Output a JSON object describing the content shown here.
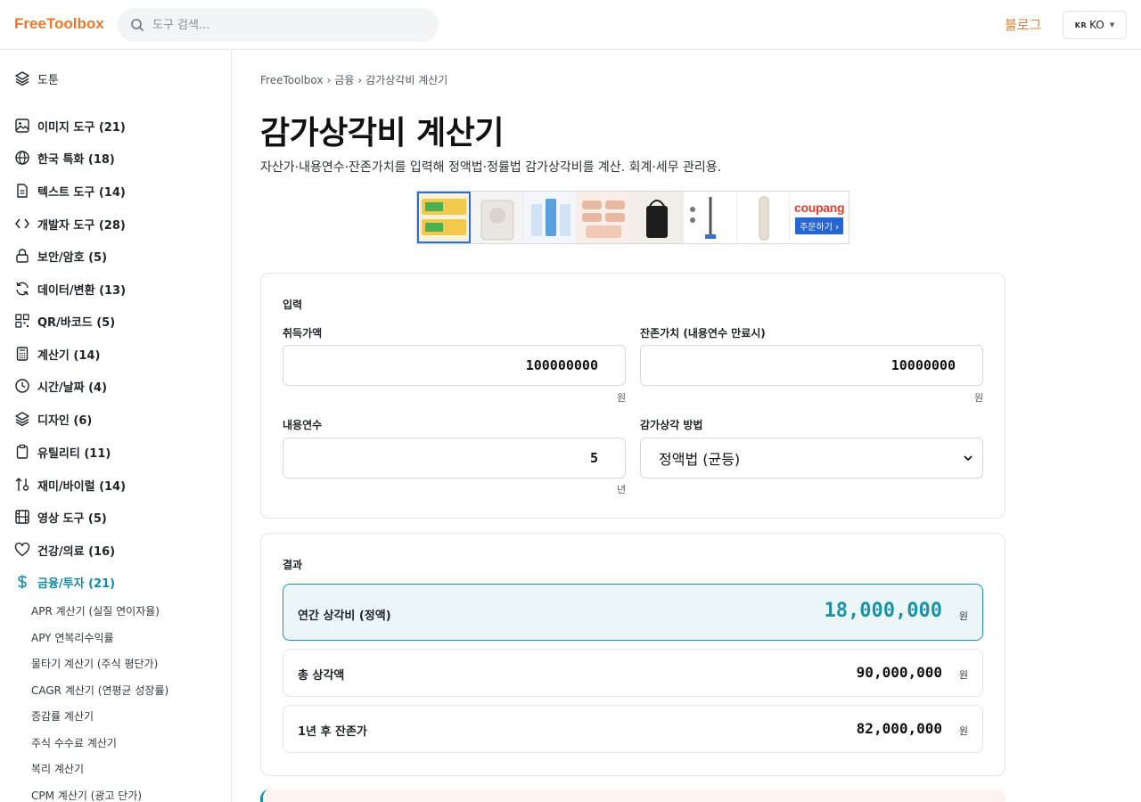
{
  "header": {
    "logo": "FreeToolbox",
    "search_placeholder": "도구 검색...",
    "blog": "블로그",
    "lang_flag": "KR",
    "lang_code": "KO"
  },
  "sidebar": {
    "top_item": "도툰",
    "categories": [
      {
        "label": "이미지 도구 (21)",
        "icon": "image-icon"
      },
      {
        "label": "한국 특화 (18)",
        "icon": "globe-icon"
      },
      {
        "label": "텍스트 도구 (14)",
        "icon": "document-icon"
      },
      {
        "label": "개발자 도구 (28)",
        "icon": "code-icon"
      },
      {
        "label": "보안/암호 (5)",
        "icon": "lock-icon"
      },
      {
        "label": "데이터/변환 (13)",
        "icon": "refresh-icon"
      },
      {
        "label": "QR/바코드 (5)",
        "icon": "qr-icon"
      },
      {
        "label": "계산기 (14)",
        "icon": "calculator-icon"
      },
      {
        "label": "시간/날짜 (4)",
        "icon": "clock-icon"
      },
      {
        "label": "디자인 (6)",
        "icon": "layers-icon"
      },
      {
        "label": "유틸리티 (11)",
        "icon": "clipboard-icon"
      },
      {
        "label": "재미/바이럴 (14)",
        "icon": "shuffle-icon"
      },
      {
        "label": "영상 도구 (5)",
        "icon": "film-icon"
      },
      {
        "label": "건강/의료 (16)",
        "icon": "heart-icon"
      },
      {
        "label": "금융/투자 (21)",
        "icon": "dollar-icon"
      }
    ],
    "finance_items": [
      "APR 계산기 (실질 연이자율)",
      "APY 연복리수익률",
      "물타기 계산기 (주식 평단가)",
      "CAGR 계산기 (연평균 성장률)",
      "증감률 계산기",
      "주식 수수료 계산기",
      "복리 계산기",
      "CPM 계산기 (광고 단가)"
    ]
  },
  "breadcrumb": [
    "FreeToolbox",
    "금융",
    "감가상각비 계산기"
  ],
  "page": {
    "title": "감가상각비 계산기",
    "description": "자산가·내용연수·잔존가치를 입력해 정액법·정률법 감가상각비를 계산. 회계·세무 관리용."
  },
  "ad": {
    "brand": "coupang",
    "order": "주문하기 ›"
  },
  "input_card": {
    "title": "입력",
    "acquisition_label": "취득가액",
    "acquisition_value": "100000000",
    "acquisition_unit": "원",
    "salvage_label": "잔존가치 (내용연수 만료시)",
    "salvage_value": "10000000",
    "salvage_unit": "원",
    "life_label": "내용연수",
    "life_value": "5",
    "life_unit": "년",
    "method_label": "감가상각 방법",
    "method_value": "정액법 (균등)"
  },
  "result_card": {
    "title": "결과",
    "rows": [
      {
        "label": "연간 상각비 (정액)",
        "value": "18,000,000",
        "unit": "원"
      },
      {
        "label": "총 상각액",
        "value": "90,000,000",
        "unit": "원"
      },
      {
        "label": "1년 후 잔존가",
        "value": "82,000,000",
        "unit": "원"
      }
    ]
  }
}
